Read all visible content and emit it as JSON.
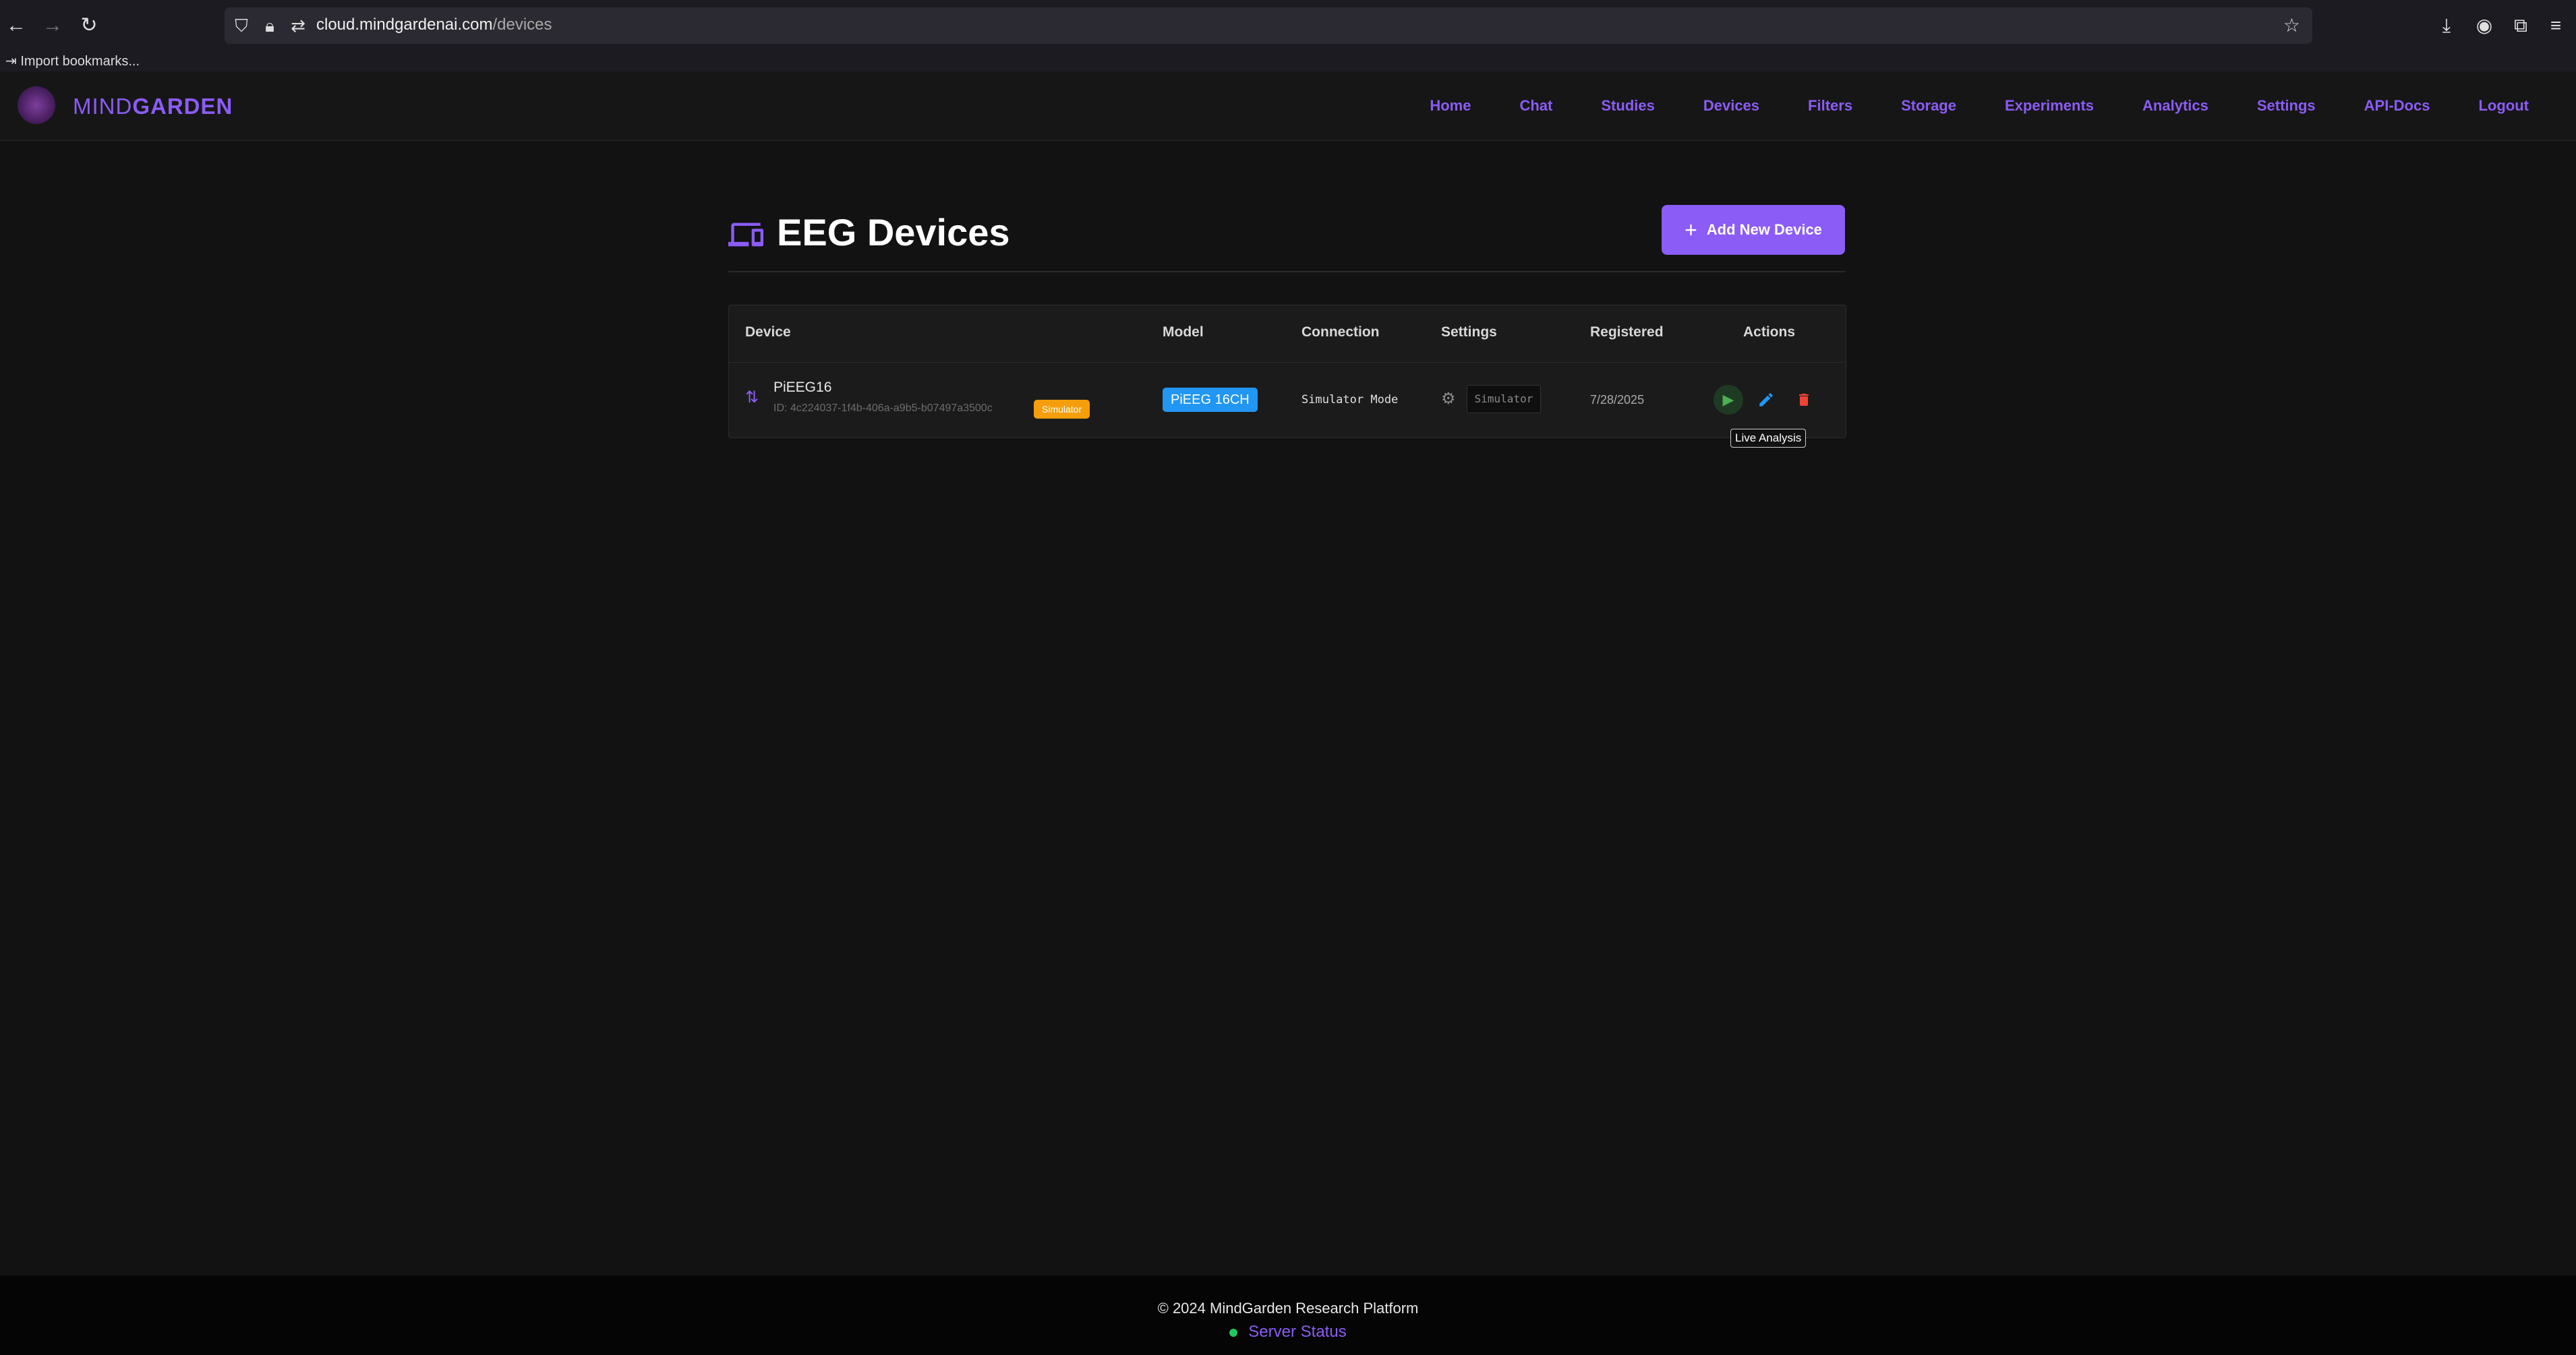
{
  "browser": {
    "url_domain": "cloud.mindgardenai.com",
    "url_path": "/devices",
    "bookmarks_item": "Import bookmarks..."
  },
  "brand": {
    "name_light": "MIND",
    "name_bold": "GARDEN"
  },
  "nav": {
    "items": [
      "Home",
      "Chat",
      "Studies",
      "Devices",
      "Filters",
      "Storage",
      "Experiments",
      "Analytics",
      "Settings",
      "API-Docs",
      "Logout"
    ]
  },
  "page": {
    "title": "EEG Devices",
    "add_button_label": "Add New Device"
  },
  "table": {
    "headers": {
      "device": "Device",
      "model": "Model",
      "connection": "Connection",
      "settings": "Settings",
      "registered": "Registered",
      "actions": "Actions"
    },
    "rows": [
      {
        "name": "PiEEG16",
        "id": "ID: 4c224037-1f4b-406a-a9b5-b07497a3500c",
        "badge": "Simulator",
        "model": "PiEEG 16CH",
        "connection": "Simulator Mode",
        "settings_value": "Simulator",
        "registered": "7/28/2025"
      }
    ]
  },
  "tooltip": "Live Analysis",
  "footer": {
    "copyright": "© 2024 MindGarden Research Platform",
    "status": "Server Status"
  },
  "colors": {
    "accent": "#8b5cf6",
    "model_badge": "#2196f3",
    "simulator_badge": "#f59e0b",
    "play": "#4caf50",
    "delete": "#f44336",
    "status_ok": "#22c55e"
  },
  "icons": [
    "back-icon",
    "forward-icon",
    "reload-icon",
    "shield-icon",
    "lock-icon",
    "permissions-icon",
    "star-icon",
    "download-icon",
    "account-icon",
    "extensions-icon",
    "menu-icon",
    "devices-icon",
    "plus-icon",
    "device-signal-icon",
    "gear-icon",
    "play-icon",
    "edit-icon",
    "delete-icon"
  ]
}
